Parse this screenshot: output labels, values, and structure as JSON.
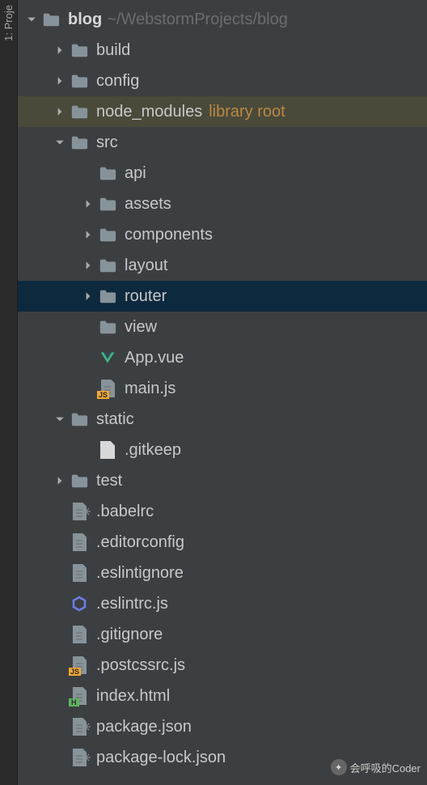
{
  "sideTab": {
    "label": "1: Proje"
  },
  "tree": {
    "root": {
      "name": "blog",
      "path": "~/WebstormProjects/blog"
    },
    "items": [
      {
        "indent": 0,
        "arrow": "open",
        "icon": "folder",
        "label": "blog",
        "bold": true,
        "hint": "~/WebstormProjects/blog"
      },
      {
        "indent": 1,
        "arrow": "closed",
        "icon": "folder",
        "label": "build"
      },
      {
        "indent": 1,
        "arrow": "closed",
        "icon": "folder",
        "label": "config"
      },
      {
        "indent": 1,
        "arrow": "closed",
        "icon": "folder",
        "label": "node_modules",
        "libHint": "library root",
        "libRoot": true
      },
      {
        "indent": 1,
        "arrow": "open",
        "icon": "folder",
        "label": "src"
      },
      {
        "indent": 2,
        "arrow": "none",
        "icon": "folder",
        "label": "api"
      },
      {
        "indent": 2,
        "arrow": "closed",
        "icon": "folder",
        "label": "assets"
      },
      {
        "indent": 2,
        "arrow": "closed",
        "icon": "folder",
        "label": "components"
      },
      {
        "indent": 2,
        "arrow": "closed",
        "icon": "folder",
        "label": "layout"
      },
      {
        "indent": 2,
        "arrow": "closed",
        "icon": "folder",
        "label": "router",
        "selected": true
      },
      {
        "indent": 2,
        "arrow": "none",
        "icon": "folder",
        "label": "view"
      },
      {
        "indent": 2,
        "arrow": "none",
        "icon": "vue",
        "label": "App.vue"
      },
      {
        "indent": 2,
        "arrow": "none",
        "icon": "js",
        "label": "main.js"
      },
      {
        "indent": 1,
        "arrow": "open",
        "icon": "folder",
        "label": "static"
      },
      {
        "indent": 2,
        "arrow": "none",
        "icon": "file-white",
        "label": ".gitkeep"
      },
      {
        "indent": 1,
        "arrow": "closed",
        "icon": "folder",
        "label": "test"
      },
      {
        "indent": 1,
        "arrow": "none",
        "icon": "cfg-gear",
        "label": ".babelrc"
      },
      {
        "indent": 1,
        "arrow": "none",
        "icon": "cfg",
        "label": ".editorconfig"
      },
      {
        "indent": 1,
        "arrow": "none",
        "icon": "cfg",
        "label": ".eslintignore"
      },
      {
        "indent": 1,
        "arrow": "none",
        "icon": "hex",
        "label": ".eslintrc.js"
      },
      {
        "indent": 1,
        "arrow": "none",
        "icon": "cfg",
        "label": ".gitignore"
      },
      {
        "indent": 1,
        "arrow": "none",
        "icon": "js",
        "label": ".postcssrc.js"
      },
      {
        "indent": 1,
        "arrow": "none",
        "icon": "html",
        "label": "index.html"
      },
      {
        "indent": 1,
        "arrow": "none",
        "icon": "cfg-gear",
        "label": "package.json"
      },
      {
        "indent": 1,
        "arrow": "none",
        "icon": "cfg-gear",
        "label": "package-lock.json"
      }
    ]
  },
  "watermark": {
    "text": "会呼吸的Coder"
  }
}
